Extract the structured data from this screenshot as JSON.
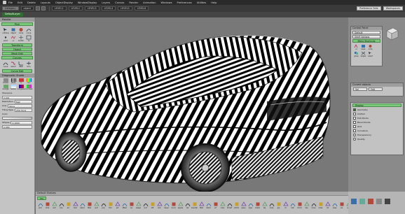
{
  "window": {
    "title": "Alias Design"
  },
  "menubar": {
    "items": [
      "File",
      "Edit",
      "Delete",
      "Layouts",
      "ObjectDisplay",
      "WindowDisplay",
      "Layers",
      "Canvas",
      "Render",
      "Animation",
      "Windows",
      "Preferences",
      "Utilities",
      "Help"
    ]
  },
  "toolbar": {
    "category_label": "Category",
    "object_label": "object",
    "level_fields": [
      "LEVEL1",
      "LEVEL2",
      "LEVEL3",
      "LEVEL4",
      "LEVEL5",
      "LEVEL6"
    ],
    "right_buttons": [
      "Preference Sets",
      "Workspaces"
    ]
  },
  "subbar": {
    "active_tab": "DefaultLayer"
  },
  "palette": {
    "title": "Palette",
    "sections": [
      {
        "header": "Pick",
        "items": [
          "nothing",
          "object",
          "comp",
          "curve",
          "point",
          "cv",
          "locator",
          "cs"
        ]
      },
      {
        "header": "Transform",
        "items": []
      },
      {
        "header": "Object",
        "items": []
      },
      {
        "header": "Mesh Edit",
        "items": []
      },
      {
        "header": "Curves",
        "items": [
          "curve",
          "blend",
          "fillet",
          "trim",
          "offset",
          "ext",
          "proj",
          "sect"
        ]
      },
      {
        "header": "Curve Edit",
        "items": []
      }
    ],
    "diagnostic_title": "Diagnostic Shade",
    "diagnostic_items": [
      "shaded",
      "zebra",
      "cv",
      "curv",
      "isoangle",
      "horizon",
      "curvgauss",
      "curvmean",
      "multicolor",
      "surface",
      "hwire",
      "deviation",
      "mesh",
      "cvgrid",
      "wire",
      "cutting"
    ],
    "tolerance_label": "Tolerance",
    "tolerance_value": "0.001",
    "resolution_label": "Resolution",
    "resolution_value": "Fast",
    "line_label": "Line",
    "line_value": "None",
    "tiling_label": "Tiling Type",
    "tiling_value": "256 Horiz",
    "color_label": "Color",
    "color_value": "Zebra",
    "stripes_label": "Stripes",
    "stripes_value": "0.1000",
    "twist_value": "0.000"
  },
  "right_panel": {
    "control_panel_title": "Control Panel",
    "control_panel_select": "Default",
    "shelf_options_label": "Shelf Options",
    "menu_shortcuts_label": "Menu Shortcuts",
    "shortcut_items": [
      "cv",
      "lsave",
      "comp",
      "group",
      "singlex",
      "select",
      "sx",
      "tsx"
    ],
    "current_objects_title": "Current objects",
    "current_objects_buttons": [
      "Sel",
      "Edit"
    ],
    "display_header": "Display",
    "display_items": [
      {
        "label": "Geometry",
        "checked": true
      },
      {
        "label": "CV/Hull",
        "checked": false
      },
      {
        "label": "Edit Points",
        "checked": false
      },
      {
        "label": "Blend Points",
        "checked": false
      },
      {
        "label": "Grid",
        "checked": false
      },
      {
        "label": "Curvature",
        "checked": false
      }
    ],
    "transparency_label": "Transparency",
    "quality_label": "Quality"
  },
  "shelf": {
    "header": "Default Shelves",
    "tab": "Obj",
    "items": [
      "pick",
      "circle",
      "rect",
      "line",
      "arc",
      "text",
      "blend",
      "fillet",
      "sect",
      "proj",
      "trim",
      "ext",
      "offset",
      "rev",
      "sweep",
      "surf",
      "loft",
      "skin",
      "bevel",
      "round",
      "square",
      "rail",
      "boundary",
      "fillet",
      "blend",
      "srf",
      "cross",
      "trimsrf",
      "untrim",
      "query",
      "layer",
      "shade",
      "obj",
      "node",
      "grp",
      "clr",
      "hist",
      "mirror",
      "dup",
      "move",
      "scale",
      "rot",
      "snap",
      "cvs",
      "edit",
      "dist"
    ]
  },
  "colors": {
    "viewport_bg": "#787878",
    "panel_green": "#7bc97b",
    "menubar_bg": "#2a2a2a"
  }
}
